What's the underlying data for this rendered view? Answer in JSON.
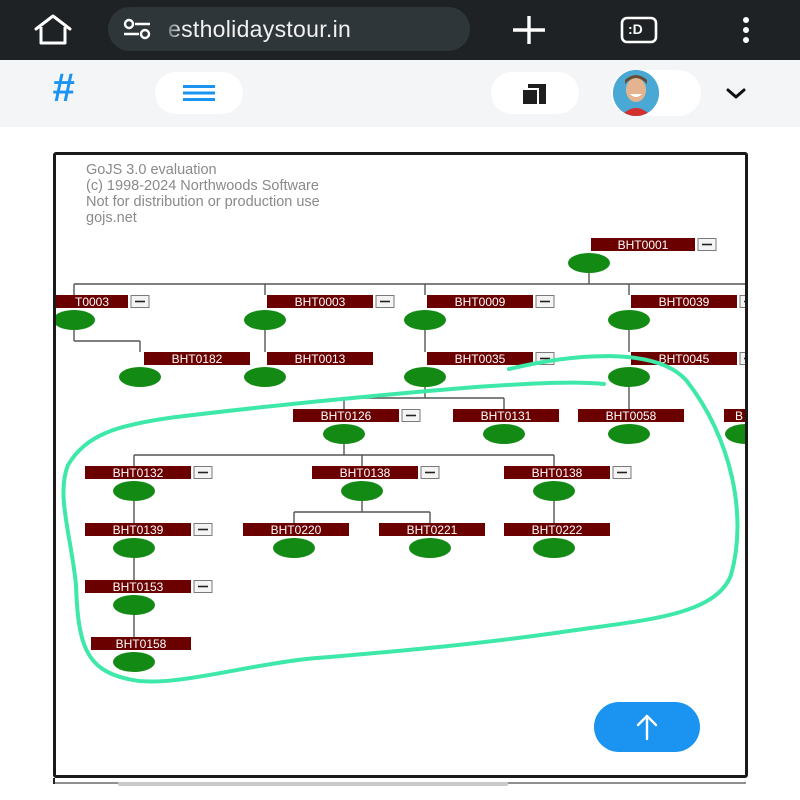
{
  "browser": {
    "url_display": "estholidaystour.in",
    "tab_count": ":D",
    "icons": [
      "home-icon",
      "site-settings-icon",
      "new-tab-icon",
      "tab-switcher-icon",
      "more-vert-icon"
    ]
  },
  "site_header": {
    "logo_symbol": "#",
    "icons": [
      "hash-logo-icon",
      "hamburger-menu-icon",
      "copy-icon",
      "avatar",
      "chevron-down-icon"
    ],
    "accent_color": "#1a94f0"
  },
  "diagram": {
    "watermark": [
      "GoJS 3.0 evaluation",
      "(c) 1998-2024 Northwoods Software",
      "Not for distribution or production use",
      "gojs.net"
    ],
    "node_label_color": "#6b0000",
    "node_circle_color": "#138a13",
    "annotation_color": "#3ee8a8",
    "nodes": [
      {
        "id": "n1",
        "label": "BHT0001",
        "collapse": true
      },
      {
        "id": "n2",
        "label": "T0003",
        "collapse": true
      },
      {
        "id": "n3",
        "label": "BHT0003",
        "collapse": true
      },
      {
        "id": "n4",
        "label": "BHT0009",
        "collapse": true
      },
      {
        "id": "n5",
        "label": "BHT0039",
        "collapse": true
      },
      {
        "id": "n6",
        "label": "BHT0182",
        "collapse": false
      },
      {
        "id": "n7",
        "label": "BHT0013",
        "collapse": false
      },
      {
        "id": "n8",
        "label": "BHT0035",
        "collapse": true
      },
      {
        "id": "n9",
        "label": "BHT0045",
        "collapse": true
      },
      {
        "id": "n10",
        "label": "BHT0126",
        "collapse": true
      },
      {
        "id": "n11",
        "label": "BHT0131",
        "collapse": false
      },
      {
        "id": "n12",
        "label": "BHT0058",
        "collapse": false
      },
      {
        "id": "n13",
        "label": "B",
        "collapse": false
      },
      {
        "id": "n14",
        "label": "BHT0132",
        "collapse": true
      },
      {
        "id": "n15",
        "label": "BHT0138",
        "collapse": true
      },
      {
        "id": "n16",
        "label": "BHT0138",
        "collapse": true
      },
      {
        "id": "n17",
        "label": "BHT0139",
        "collapse": true
      },
      {
        "id": "n18",
        "label": "BHT0220",
        "collapse": false
      },
      {
        "id": "n19",
        "label": "BHT0221",
        "collapse": false
      },
      {
        "id": "n20",
        "label": "BHT0222",
        "collapse": false
      },
      {
        "id": "n21",
        "label": "BHT0153",
        "collapse": true
      },
      {
        "id": "n22",
        "label": "BHT0158",
        "collapse": false
      }
    ]
  },
  "scroll_top_button": {
    "icon": "arrow-up-icon"
  }
}
